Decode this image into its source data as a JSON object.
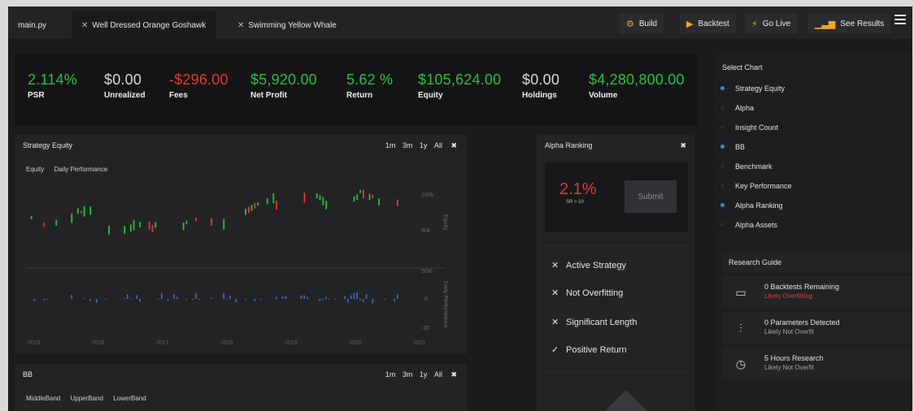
{
  "tabs": [
    {
      "label": "main.py",
      "closable": false
    },
    {
      "label": "Well Dressed Orange Goshawk",
      "closable": true
    },
    {
      "label": "Swimming Yellow Whale",
      "closable": true
    }
  ],
  "toolbar": {
    "build": "Build",
    "backtest": "Backtest",
    "golive": "Go Live",
    "results": "See Results"
  },
  "stats": [
    {
      "value": "2.114%",
      "label": "PSR",
      "color": "#26c33b"
    },
    {
      "value": "$0.00",
      "label": "Unrealized",
      "color": "#d9d9d9"
    },
    {
      "value": "-$296.00",
      "label": "Fees",
      "color": "#e33b2e"
    },
    {
      "value": "$5,920.00",
      "label": "Net Profit",
      "color": "#26c33b"
    },
    {
      "value": "5.62 %",
      "label": "Return",
      "color": "#26c33b"
    },
    {
      "value": "$105,624.00",
      "label": "Equity",
      "color": "#26c33b"
    },
    {
      "value": "$0.00",
      "label": "Holdings",
      "color": "#d9d9d9"
    },
    {
      "value": "$4,280,800.00",
      "label": "Volume",
      "color": "#26c33b"
    }
  ],
  "equity_panel": {
    "title": "Strategy Equity",
    "ranges": [
      "1m",
      "3m",
      "1y",
      "All"
    ],
    "legend": [
      "Equity",
      "Daily Performance"
    ],
    "years": [
      "2015",
      "2016",
      "2017",
      "2018",
      "2019",
      "2020",
      "2021"
    ],
    "equity_ticks": [
      "100k",
      "80k"
    ],
    "perf_ticks": [
      "50%",
      "0",
      "-20"
    ],
    "equity_axis_label": "Equity",
    "perf_axis_label": "Daily Performance"
  },
  "bb_panel": {
    "title": "BB",
    "ranges": [
      "1m",
      "3m",
      "1y",
      "All"
    ],
    "legend": [
      "MiddleBand",
      "UpperBand",
      "LowerBand"
    ]
  },
  "alpha_panel": {
    "title": "Alpha Ranking",
    "score": "2.1%",
    "score_sub": "SR > 10",
    "submit": "Submit",
    "checks": [
      {
        "label": "Active Strategy",
        "passed": false
      },
      {
        "label": "Not Overfitting",
        "passed": false
      },
      {
        "label": "Significant Length",
        "passed": false
      },
      {
        "label": "Positive Return",
        "passed": true
      }
    ]
  },
  "select_chart": {
    "title": "Select Chart",
    "items": [
      {
        "label": "Strategy Equity",
        "selected": true
      },
      {
        "label": "Alpha",
        "selected": false
      },
      {
        "label": "Insight Count",
        "selected": false
      },
      {
        "label": "BB",
        "selected": true
      },
      {
        "label": "Benchmark",
        "selected": false
      },
      {
        "label": "Key Performance",
        "selected": false
      },
      {
        "label": "Alpha Ranking",
        "selected": true
      },
      {
        "label": "Alpha Assets",
        "selected": false
      }
    ]
  },
  "research_guide": {
    "title": "Research Guide",
    "items": [
      {
        "title": "0 Backtests Remaining",
        "status": "Likely Overfitting",
        "warn": true,
        "icon": "battery-icon"
      },
      {
        "title": "0 Parameters Detected",
        "status": "Likely Not Overfit",
        "warn": false,
        "icon": "sliders-icon"
      },
      {
        "title": "5 Hours Research",
        "status": "Likely Not Overfit",
        "warn": false,
        "icon": "clock-icon"
      }
    ]
  },
  "colors": {
    "accent": "#f2a52b",
    "up": "#26c33b",
    "down": "#e33b2e",
    "selected_dot": "#2d8fdd"
  }
}
